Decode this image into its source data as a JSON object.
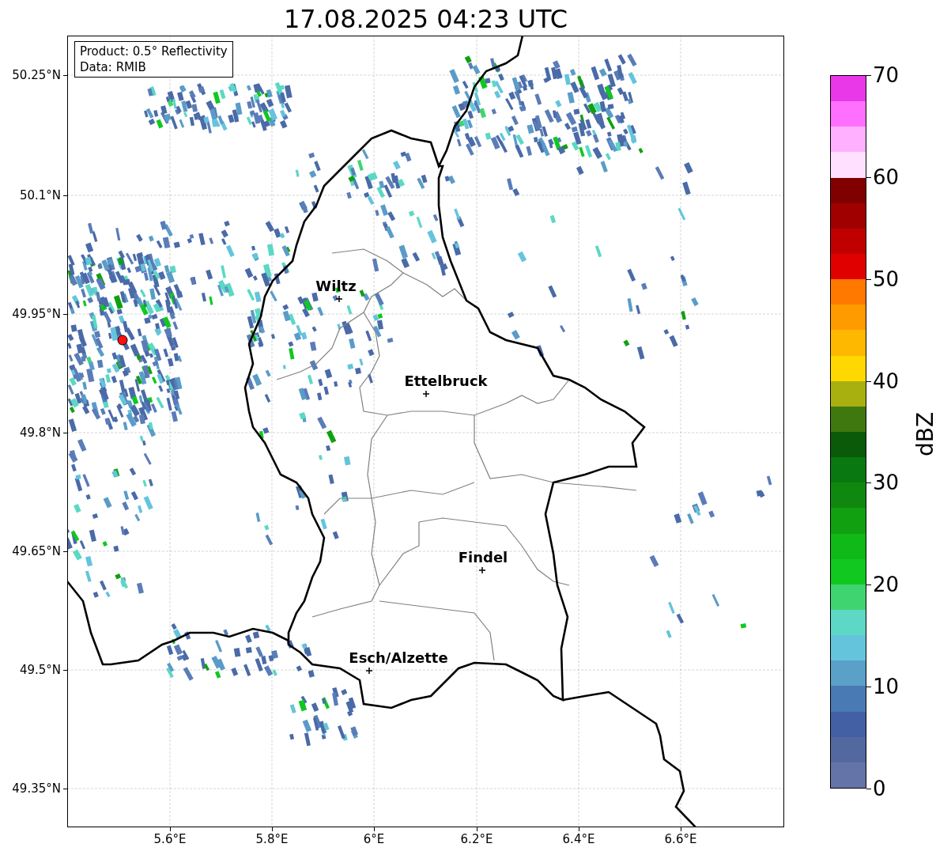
{
  "title": "17.08.2025 04:23 UTC",
  "info_box": [
    "Product: 0.5° Reflectivity",
    "Data: RMIB"
  ],
  "cities": [
    {
      "name": "Wiltz"
    },
    {
      "name": "Ettelbruck"
    },
    {
      "name": "Findel"
    },
    {
      "name": "Esch/Alzette"
    }
  ],
  "y_ticks": [
    "50.25°N",
    "50.1°N",
    "49.95°N",
    "49.8°N",
    "49.65°N",
    "49.5°N",
    "49.35°N"
  ],
  "x_ticks": [
    "5.6°E",
    "5.8°E",
    "6°E",
    "6.2°E",
    "6.4°E",
    "6.6°E"
  ],
  "colorbar": {
    "label": "dBZ",
    "ticks": [
      "70",
      "60",
      "50",
      "40",
      "30",
      "20",
      "10",
      "0"
    ],
    "bands": [
      {
        "color": "#e838e8"
      },
      {
        "color": "#ff70ff"
      },
      {
        "color": "#ffb0ff"
      },
      {
        "color": "#ffe0ff"
      },
      {
        "color": "#800000"
      },
      {
        "color": "#a00000"
      },
      {
        "color": "#c00000"
      },
      {
        "color": "#e00000"
      },
      {
        "color": "#ff7800"
      },
      {
        "color": "#ff9a00"
      },
      {
        "color": "#ffb800"
      },
      {
        "color": "#ffd800"
      },
      {
        "color": "#a8b010"
      },
      {
        "color": "#407810"
      },
      {
        "color": "#0a5a0a"
      },
      {
        "color": "#0a7810"
      },
      {
        "color": "#108810"
      },
      {
        "color": "#10a010"
      },
      {
        "color": "#10b818"
      },
      {
        "color": "#10c820"
      },
      {
        "color": "#40d470"
      },
      {
        "color": "#5cd8c4"
      },
      {
        "color": "#64c4dc"
      },
      {
        "color": "#5aa0c8"
      },
      {
        "color": "#4a7ab4"
      },
      {
        "color": "#4460a4"
      },
      {
        "color": "#5468a0"
      },
      {
        "color": "#6474a8"
      }
    ]
  }
}
